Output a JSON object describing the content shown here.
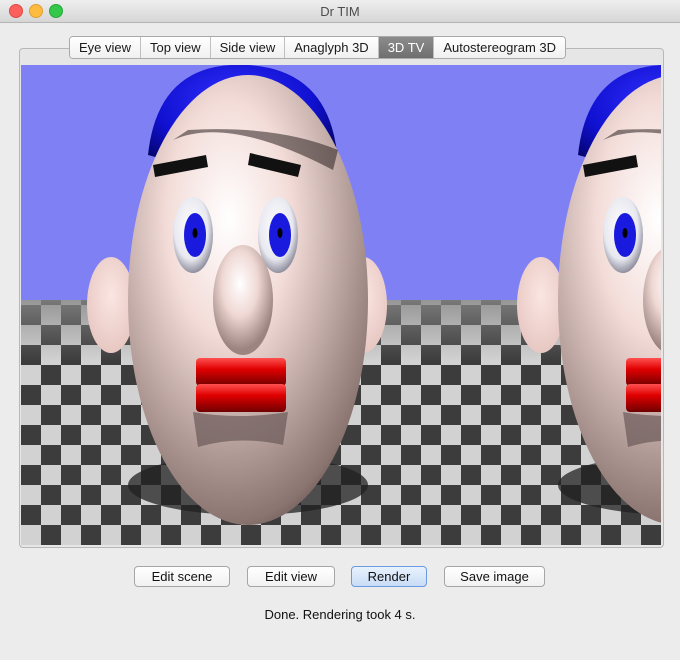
{
  "window": {
    "title": "Dr TIM"
  },
  "tabs": [
    {
      "label": "Eye view"
    },
    {
      "label": "Top view"
    },
    {
      "label": "Side view"
    },
    {
      "label": "Anaglyph 3D"
    },
    {
      "label": "3D TV",
      "selected": true
    },
    {
      "label": "Autostereogram 3D"
    }
  ],
  "scene": {
    "sky_color": "#8080f5",
    "floor_dark": "#3c3c3c",
    "floor_light": "#d2d2d2",
    "face_color": "#f3dcd8",
    "hat_color": "#1010d0",
    "lips_color": "#e00000",
    "iris_color": "#1a1adf"
  },
  "buttons": {
    "edit_scene": "Edit scene",
    "edit_view": "Edit view",
    "render": "Render",
    "save_image": "Save image"
  },
  "status": "Done.  Rendering took 4 s."
}
